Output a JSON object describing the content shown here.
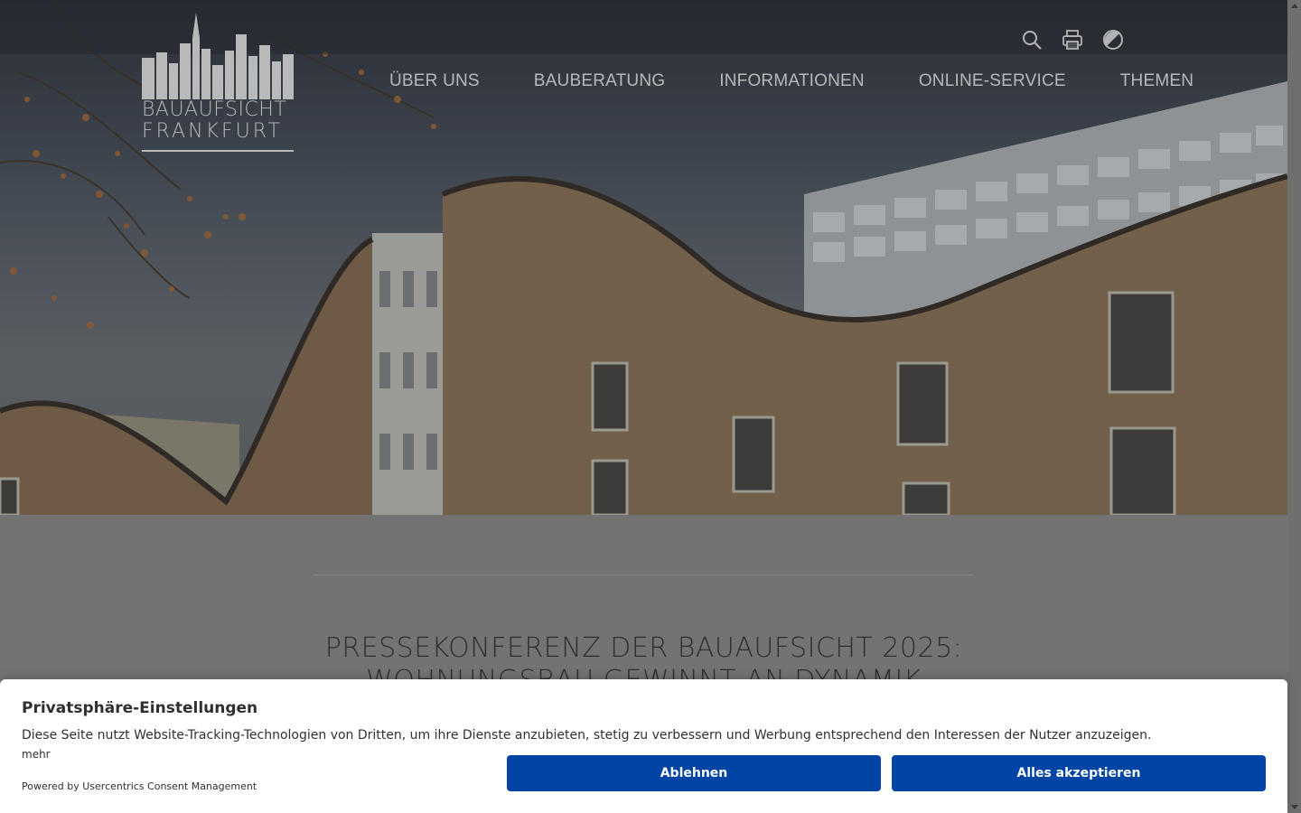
{
  "site": {
    "logo": {
      "line1": "BAUAUFSICHT",
      "line2": "FRANKFURT"
    },
    "tools": {
      "search_icon": "search-icon",
      "print_icon": "print-icon",
      "contrast_icon": "contrast-icon"
    },
    "nav": {
      "items": [
        {
          "label": "ÜBER UNS"
        },
        {
          "label": "BAUBERATUNG"
        },
        {
          "label": "INFORMATIONEN"
        },
        {
          "label": "ONLINE-SERVICE"
        },
        {
          "label": "THEMEN"
        }
      ]
    }
  },
  "main": {
    "headline_line1": "PRESSEKONFERENZ DER BAUAUFSICHT 2025:",
    "headline_line2": "WOHNUNGSBAU GEWINNT AN DYNAMIK"
  },
  "consent": {
    "title": "Privatsphäre-Einstellungen",
    "description": "Diese Seite nutzt Website-Tracking-Technologien von Dritten, um ihre Dienste anzubieten, stetig zu verbessern und Werbung entsprechend den Interessen der Nutzer anzuzeigen.",
    "more_label": "mehr",
    "powered_by": "Powered by Usercentrics Consent Management",
    "deny_label": "Ablehnen",
    "accept_label": "Alles akzeptieren"
  },
  "colors": {
    "button_blue": "#0045a5",
    "overlay_gray": "#737373"
  }
}
